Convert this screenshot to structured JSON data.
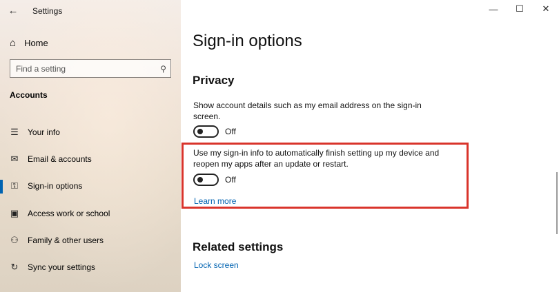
{
  "window": {
    "title": "Settings",
    "controls": {
      "minimize": "—",
      "maximize": "☐",
      "close": "✕"
    }
  },
  "sidebar": {
    "back_icon": "←",
    "home": {
      "label": "Home",
      "icon": "⌂"
    },
    "search": {
      "placeholder": "Find a setting",
      "icon": "⚲"
    },
    "section_label": "Accounts",
    "items": [
      {
        "label": "Your info",
        "icon": "☰"
      },
      {
        "label": "Email & accounts",
        "icon": "✉"
      },
      {
        "label": "Sign-in options",
        "icon": "⚿"
      },
      {
        "label": "Access work or school",
        "icon": "▣"
      },
      {
        "label": "Family & other users",
        "icon": "⚇"
      },
      {
        "label": "Sync your settings",
        "icon": "↻"
      }
    ],
    "active_index": 2,
    "accent_color": "#0063b1"
  },
  "main": {
    "title": "Sign-in options",
    "privacy": {
      "heading": "Privacy",
      "setting1": {
        "description": "Show account details such as my email address on the sign-in screen.",
        "state": "Off"
      },
      "setting2": {
        "description": "Use my sign-in info to automatically finish setting up my device and reopen my apps after an update or restart.",
        "state": "Off"
      },
      "learn_more": "Learn more"
    },
    "related": {
      "heading": "Related settings",
      "lock_screen": "Lock screen"
    },
    "highlight_color": "#d9342b"
  }
}
